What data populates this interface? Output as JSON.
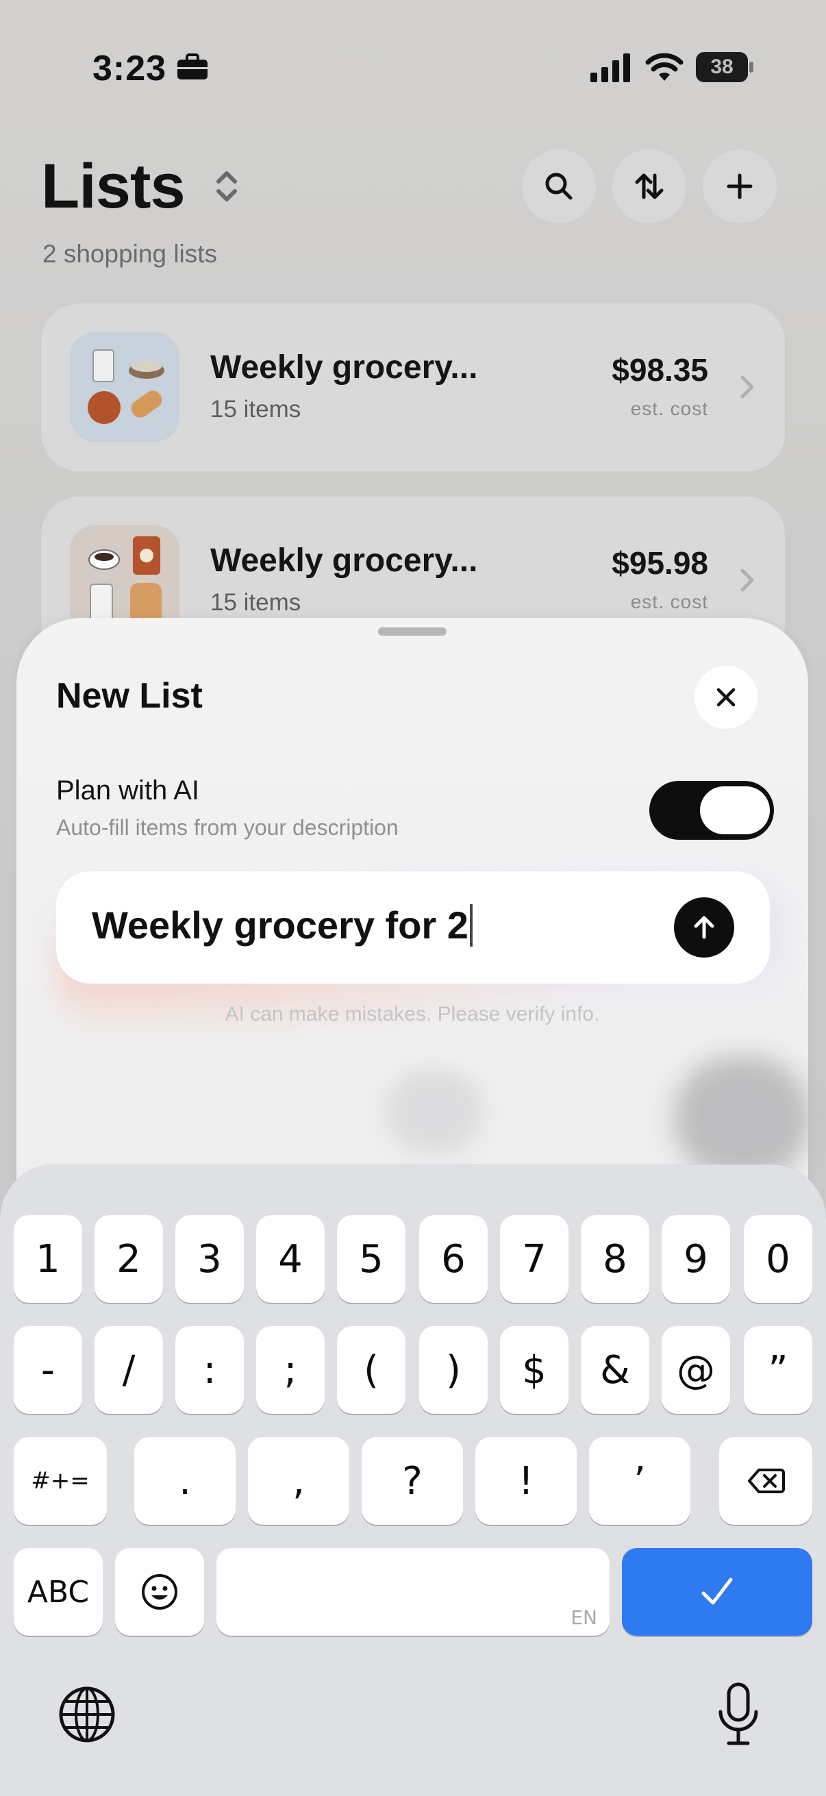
{
  "status_bar": {
    "time": "3:23",
    "battery": "38"
  },
  "header": {
    "title": "Lists",
    "subtitle": "2 shopping lists"
  },
  "toolbar": {
    "search_icon": "search-icon",
    "sort_icon": "sort-icon",
    "add_icon": "plus-icon"
  },
  "lists": [
    {
      "title": "Weekly grocery...",
      "items": "15 items",
      "cost": "$98.35",
      "cost_label": "est. cost"
    },
    {
      "title": "Weekly grocery...",
      "items": "15 items",
      "cost": "$95.98",
      "cost_label": "est. cost"
    }
  ],
  "sheet": {
    "title": "New List",
    "ai_label": "Plan with AI",
    "ai_description": "Auto-fill items from your description",
    "ai_enabled": true,
    "prompt_value": "Weekly grocery for 2",
    "disclaimer": "AI can make mistakes. Please verify info."
  },
  "keyboard": {
    "row1": [
      "1",
      "2",
      "3",
      "4",
      "5",
      "6",
      "7",
      "8",
      "9",
      "0"
    ],
    "row2": [
      "-",
      "/",
      ":",
      ";",
      "(",
      ")",
      "$",
      "&",
      "@",
      "”"
    ],
    "row3": [
      "#+=",
      ".",
      ",",
      "?",
      "!",
      "’"
    ],
    "abc": "ABC",
    "lang": "EN"
  },
  "colors": {
    "accent": "#2f7af0",
    "toggle_on": "#0e0e0e"
  }
}
